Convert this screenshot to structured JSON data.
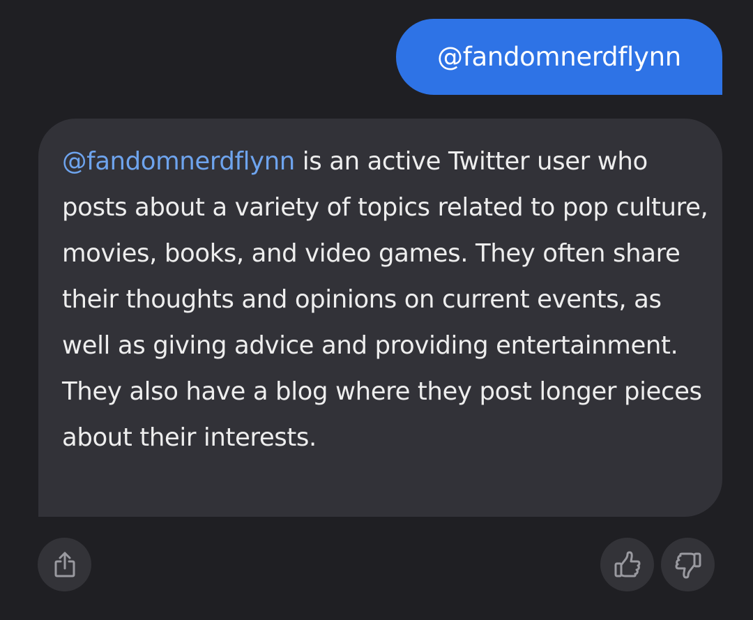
{
  "conversation": {
    "user_message": "@fandomnerdflynn",
    "reply": {
      "mention": "@fandomnerdflynn",
      "text": " is an active Twitter user who posts about a variety of topics related to pop culture, movies, books, and video games. They often share their thoughts and opinions on current events, as well as giving advice and providing entertainment. They also have a blog where they post longer pieces about their interests."
    }
  },
  "actions": {
    "share_icon": "share-icon",
    "like_icon": "thumbs-up-icon",
    "dislike_icon": "thumbs-down-icon"
  },
  "colors": {
    "background": "#1f1f23",
    "user_bubble": "#2e73e6",
    "bot_bubble": "#323238",
    "mention": "#6ea4ee",
    "action_button": "#333338"
  }
}
